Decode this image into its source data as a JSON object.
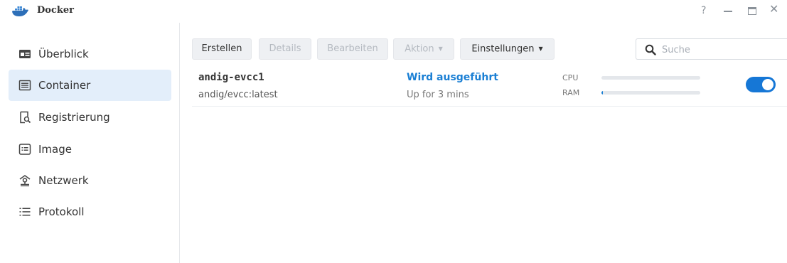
{
  "window": {
    "title": "Docker",
    "help_label": "?",
    "close_label": "✕"
  },
  "sidebar": {
    "items": [
      {
        "label": "Überblick",
        "icon": "overview-icon",
        "active": false
      },
      {
        "label": "Container",
        "icon": "container-list-icon",
        "active": true
      },
      {
        "label": "Registrierung",
        "icon": "registry-search-icon",
        "active": false
      },
      {
        "label": "Image",
        "icon": "image-icon",
        "active": false
      },
      {
        "label": "Netzwerk",
        "icon": "network-icon",
        "active": false
      },
      {
        "label": "Protokoll",
        "icon": "log-list-icon",
        "active": false
      }
    ]
  },
  "toolbar": {
    "create_label": "Erstellen",
    "details_label": "Details",
    "edit_label": "Bearbeiten",
    "action_label": "Aktion",
    "settings_label": "Einstellungen",
    "caret": "▼"
  },
  "search": {
    "placeholder": "Suche",
    "value": ""
  },
  "containers": [
    {
      "name": "andig-evcc1",
      "image": "andig/evcc:latest",
      "status": "Wird ausgeführt",
      "uptime": "Up for 3 mins",
      "cpu_label": "CPU",
      "ram_label": "RAM",
      "cpu_usage_fraction": 0.0,
      "ram_usage_fraction": 0.01,
      "running": true
    }
  ],
  "colors": {
    "accent": "#1677d6",
    "status_running": "#1a7fd4",
    "active_nav_bg": "#e3eefa"
  }
}
